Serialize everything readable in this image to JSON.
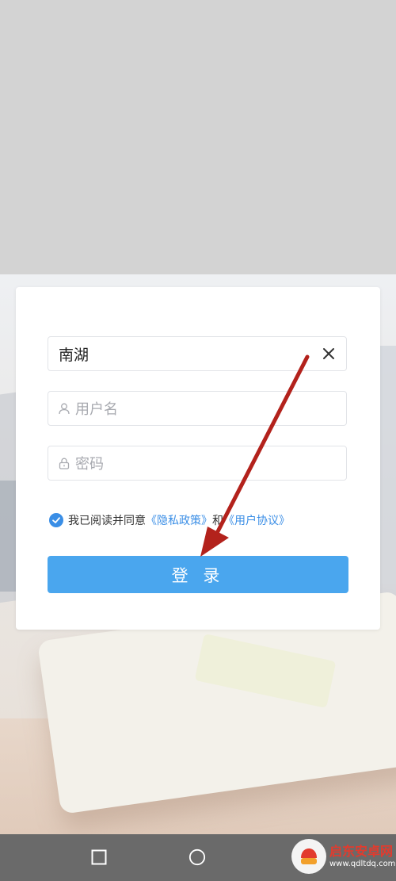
{
  "login_form": {
    "school_value": "南湖",
    "username_placeholder": "用户名",
    "password_placeholder": "密码",
    "agreement": {
      "checked": true,
      "prefix": "我已阅读并同意",
      "privacy_link": "《隐私政策》",
      "conjunction": "和",
      "terms_link": "《用户协议》"
    },
    "login_button": "登 录"
  },
  "nav_bar": {
    "icons": [
      "square-icon",
      "circle-icon"
    ]
  },
  "watermark": {
    "title": "启东安卓网",
    "url": "www.qdltdq.com"
  },
  "colors": {
    "accent": "#4aa6ee",
    "link": "#3a8ee6",
    "annotation_arrow": "#b3221c"
  }
}
